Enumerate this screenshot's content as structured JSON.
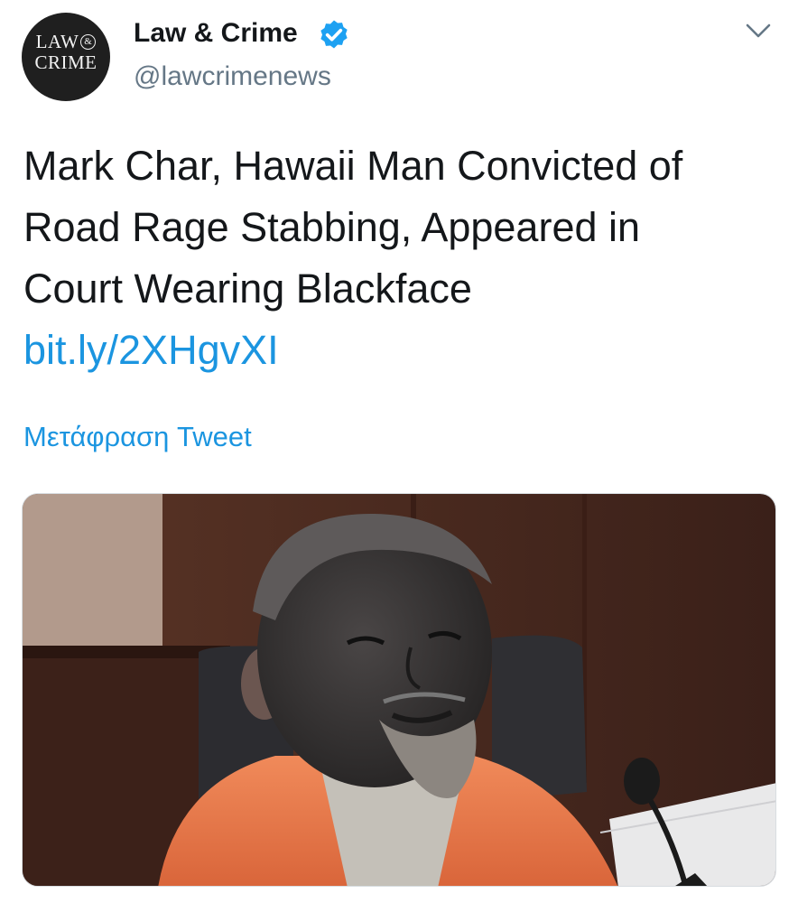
{
  "tweet": {
    "avatar_text_line1": "LAW",
    "avatar_text_amp": "&",
    "avatar_text_line2": "CRIME",
    "display_name": "Law & Crime",
    "handle": "@lawcrimenews",
    "verified": true,
    "text_lines": [
      "Mark Char, Hawaii Man Convicted of",
      "Road Rage Stabbing, Appeared in",
      "Court Wearing Blackface"
    ],
    "link": "bit.ly/2XHgvXI",
    "translate_label": "Μετάφραση Tweet"
  },
  "icons": {
    "verified": "verified-badge-icon",
    "menu": "chevron-down-icon"
  },
  "colors": {
    "link": "#1b95e0",
    "verified": "#1da1f2",
    "secondary_text": "#657786"
  }
}
